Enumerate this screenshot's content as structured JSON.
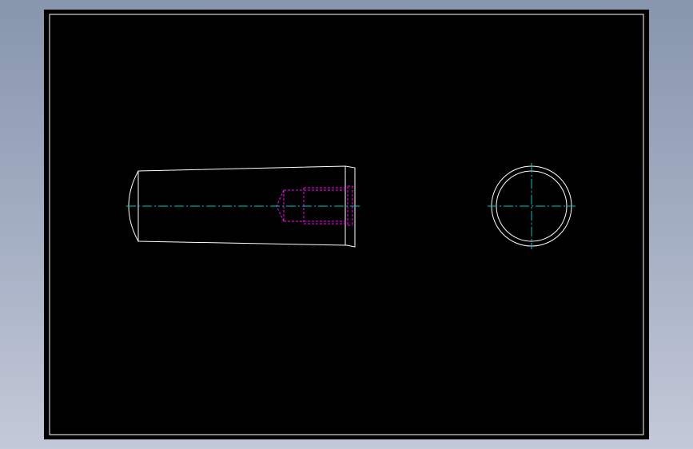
{
  "drawing": {
    "background_color": "#000000",
    "outline_color": "#ffffff",
    "hidden_line_color": "#ff00ff",
    "center_line_color": "#00c8c8",
    "views": [
      "side-view",
      "end-view"
    ]
  }
}
